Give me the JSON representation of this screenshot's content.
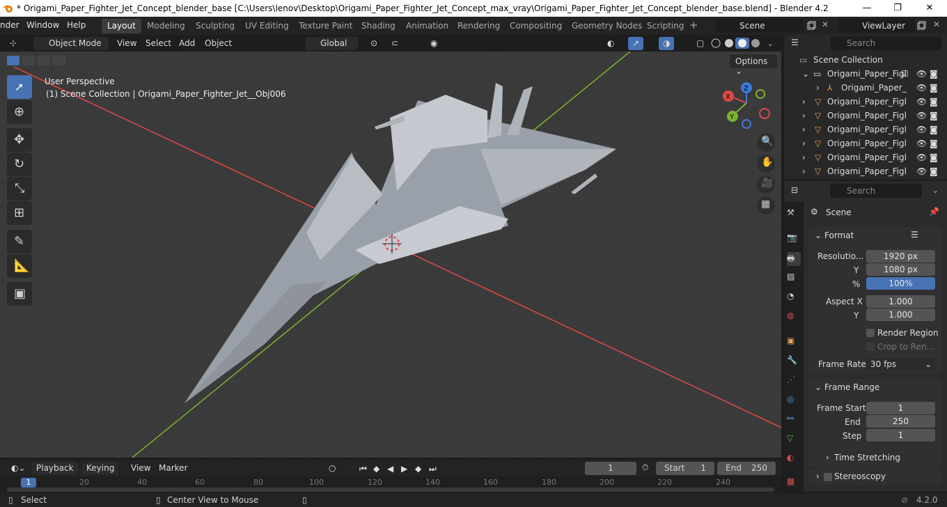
{
  "window": {
    "title": "* Origami_Paper_Fighter_Jet_Concept_blender_base [C:\\Users\\lenov\\Desktop\\Origami_Paper_Fighter_Jet_Concept_max_vray\\Origami_Paper_Fighter_Jet_Concept_blender_base.blend] - Blender 4.2",
    "minimize": "—",
    "maximize": "❐",
    "close": "✕"
  },
  "menu": [
    "nder",
    "Window",
    "Help"
  ],
  "workspaces": [
    "Layout",
    "Modeling",
    "Sculpting",
    "UV Editing",
    "Texture Paint",
    "Shading",
    "Animation",
    "Rendering",
    "Compositing",
    "Geometry Nodes",
    "Scripting"
  ],
  "add_workspace": "+",
  "scene_field": "Scene",
  "viewlayer_field": "ViewLayer",
  "viewport_header": {
    "mode": "Object Mode",
    "menus": [
      "View",
      "Select",
      "Add",
      "Object"
    ],
    "orientation": "Global",
    "options": "Options"
  },
  "viewport": {
    "perspective": "User Perspective",
    "collection_info": "(1) Scene Collection | Origami_Paper_Fighter_Jet__Obj006",
    "gizmo": {
      "x": "X",
      "y": "Y",
      "z": "Z"
    }
  },
  "outliner": {
    "search_placeholder": "Search",
    "root": "Scene Collection",
    "items": [
      {
        "label": "Origami_Paper_Figl",
        "type": "collection"
      },
      {
        "label": "Origami_Paper_",
        "type": "armature"
      },
      {
        "label": "Origami_Paper_Figl",
        "type": "mesh"
      },
      {
        "label": "Origami_Paper_Figl",
        "type": "mesh"
      },
      {
        "label": "Origami_Paper_Figl",
        "type": "mesh"
      },
      {
        "label": "Origami_Paper_Figl",
        "type": "mesh"
      },
      {
        "label": "Origami_Paper_Figl",
        "type": "mesh"
      },
      {
        "label": "Origami_Paper_Figl",
        "type": "mesh"
      }
    ]
  },
  "properties": {
    "search_placeholder": "Search",
    "context": "Scene",
    "format": {
      "title": "Format",
      "resolution_label": "Resolutio...",
      "resolution_x": "1920 px",
      "y_label": "Y",
      "resolution_y": "1080 px",
      "percent_label": "%",
      "percent": "100%",
      "aspect_label": "Aspect X",
      "aspect_x": "1.000",
      "aspect_y_label": "Y",
      "aspect_y": "1.000",
      "render_region": "Render Region",
      "crop": "Crop to Ren...",
      "frame_rate_label": "Frame Rate",
      "frame_rate": "30 fps"
    },
    "frame_range": {
      "title": "Frame Range",
      "start_label": "Frame Start",
      "start": "1",
      "end_label": "End",
      "end": "250",
      "step_label": "Step",
      "step": "1"
    },
    "time_stretching": "Time Stretching",
    "stereoscopy": "Stereoscopy"
  },
  "timeline": {
    "menus": [
      "Playback",
      "Keying",
      "View",
      "Marker"
    ],
    "current_frame": "1",
    "start_label": "Start",
    "start": "1",
    "end_label": "End",
    "end": "250",
    "ticks": [
      "1",
      "20",
      "40",
      "60",
      "80",
      "100",
      "120",
      "140",
      "160",
      "180",
      "200",
      "220",
      "240"
    ]
  },
  "statusbar": {
    "select": "Select",
    "center": "Center View to Mouse",
    "version": "4.2.0"
  },
  "colors": {
    "accent": "#4772b3",
    "x_axis": "#e04848",
    "y_axis": "#7cb32e",
    "z_axis": "#3c7ad8"
  }
}
